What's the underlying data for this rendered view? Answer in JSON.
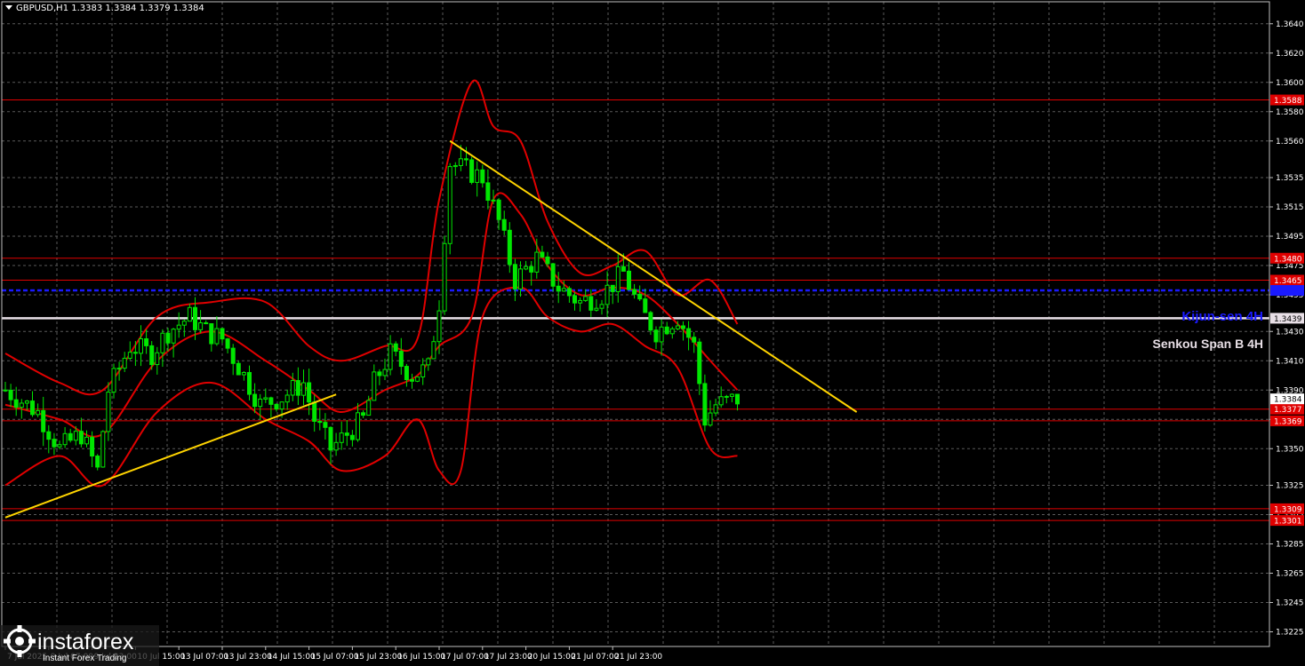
{
  "window": {
    "symbol_title": "GBPUSD,H1  1.3383 1.3384 1.3379 1.3384",
    "watermark_brand": "instaforex",
    "watermark_tagline": "Instant Forex Trading"
  },
  "colors": {
    "background": "#000000",
    "grid": "#5a5a5a",
    "candles": "#00e600",
    "bollinger": "#e00000",
    "level_red": "#e00000",
    "kijun": "#1a1aff",
    "senkou": "#e8dfe6",
    "trendline": "#ffd400"
  },
  "chart_data": {
    "type": "candlestick",
    "instrument": "GBPUSD",
    "timeframe": "H1",
    "title": "GBPUSD,H1  1.3383 1.3384 1.3379 1.3384",
    "ylim": [
      1.3215,
      1.3655
    ],
    "y_ticks": [
      "1.3640",
      "1.3620",
      "1.3600",
      "1.3580",
      "1.3560",
      "1.3535",
      "1.3515",
      "1.3495",
      "1.3475",
      "1.3455",
      "1.3430",
      "1.3410",
      "1.3390",
      "1.3370",
      "1.3350",
      "1.3325",
      "1.3305",
      "1.3285",
      "1.3265",
      "1.3245",
      "1.3225"
    ],
    "x_ticks": [
      "7 Jul 2025",
      "9 Jul 07:00",
      "9 Jul 23:00",
      "10 Jul 15:00",
      "13 Jul 07:00",
      "13 Jul 23:00",
      "14 Jul 15:00",
      "15 Jul 07:00",
      "15 Jul 23:00",
      "16 Jul 15:00",
      "17 Jul 07:00",
      "17 Jul 23:00",
      "20 Jul 15:00",
      "21 Jul 07:00",
      "21 Jul 23:00"
    ],
    "x_tick_bars": [
      0,
      8,
      16,
      24,
      32,
      40,
      48,
      56,
      64,
      72,
      80,
      88,
      96,
      104,
      112
    ],
    "bar_count": 150,
    "grid": true,
    "current_price": "1.3384",
    "current_price_value": 1.3384,
    "levels": [
      {
        "label": "1.3588",
        "value": 1.3588,
        "color": "#e00000"
      },
      {
        "label": "1.3480",
        "value": 1.348,
        "color": "#e00000"
      },
      {
        "label": "1.3465",
        "value": 1.3465,
        "color": "#e00000"
      },
      {
        "label": "1.3377",
        "value": 1.3377,
        "color": "#e00000"
      },
      {
        "label": "1.3369",
        "value": 1.3369,
        "color": "#e00000"
      },
      {
        "label": "1.3309",
        "value": 1.3309,
        "color": "#e00000"
      },
      {
        "label": "1.3301",
        "value": 1.3301,
        "color": "#e00000"
      }
    ],
    "kijun": {
      "label": "Kijun-sen 4H",
      "value": 1.3458,
      "color": "#1a1aff"
    },
    "senkou": {
      "label": "Senkou Span B 4H",
      "tag": "1.3439",
      "value": 1.3439,
      "color": "#e8dfe6"
    },
    "trendlines": [
      {
        "from": [
          0,
          1.3303
        ],
        "to": [
          61,
          1.3387
        ],
        "color": "#ffd400"
      },
      {
        "from": [
          82,
          1.356
        ],
        "to": [
          157,
          1.3375
        ],
        "color": "#ffd400"
      }
    ],
    "price_path": [
      [
        0,
        1.339
      ],
      [
        6,
        1.3375
      ],
      [
        10,
        1.335
      ],
      [
        14,
        1.336
      ],
      [
        17,
        1.3335
      ],
      [
        19,
        1.339
      ],
      [
        23,
        1.342
      ],
      [
        27,
        1.3415
      ],
      [
        30,
        1.343
      ],
      [
        34,
        1.344
      ],
      [
        37,
        1.343
      ],
      [
        40,
        1.3425
      ],
      [
        44,
        1.34
      ],
      [
        47,
        1.338
      ],
      [
        51,
        1.3385
      ],
      [
        55,
        1.3395
      ],
      [
        57,
        1.337
      ],
      [
        60,
        1.335
      ],
      [
        63,
        1.336
      ],
      [
        66,
        1.337
      ],
      [
        68,
        1.3395
      ],
      [
        71,
        1.3415
      ],
      [
        75,
        1.34
      ],
      [
        78,
        1.3405
      ],
      [
        80,
        1.345
      ],
      [
        82,
        1.3545
      ],
      [
        85,
        1.354
      ],
      [
        88,
        1.3535
      ],
      [
        91,
        1.3505
      ],
      [
        94,
        1.3465
      ],
      [
        98,
        1.348
      ],
      [
        102,
        1.346
      ],
      [
        106,
        1.345
      ],
      [
        110,
        1.3455
      ],
      [
        114,
        1.347
      ],
      [
        117,
        1.3445
      ],
      [
        120,
        1.343
      ],
      [
        124,
        1.344
      ],
      [
        127,
        1.342
      ],
      [
        129,
        1.337
      ],
      [
        131,
        1.338
      ],
      [
        135,
        1.3384
      ]
    ],
    "bollinger_bands": {
      "upper": [
        [
          0,
          1.3415
        ],
        [
          10,
          1.3395
        ],
        [
          18,
          1.339
        ],
        [
          28,
          1.344
        ],
        [
          38,
          1.345
        ],
        [
          48,
          1.345
        ],
        [
          56,
          1.342
        ],
        [
          62,
          1.341
        ],
        [
          70,
          1.342
        ],
        [
          76,
          1.3425
        ],
        [
          80,
          1.352
        ],
        [
          86,
          1.36
        ],
        [
          90,
          1.357
        ],
        [
          95,
          1.356
        ],
        [
          100,
          1.3505
        ],
        [
          106,
          1.347
        ],
        [
          112,
          1.3475
        ],
        [
          118,
          1.3485
        ],
        [
          124,
          1.3455
        ],
        [
          130,
          1.3465
        ],
        [
          135,
          1.3435
        ]
      ],
      "middle": [
        [
          0,
          1.338
        ],
        [
          10,
          1.337
        ],
        [
          18,
          1.336
        ],
        [
          28,
          1.341
        ],
        [
          38,
          1.343
        ],
        [
          48,
          1.341
        ],
        [
          56,
          1.339
        ],
        [
          62,
          1.3375
        ],
        [
          70,
          1.339
        ],
        [
          76,
          1.34
        ],
        [
          80,
          1.342
        ],
        [
          86,
          1.344
        ],
        [
          90,
          1.352
        ],
        [
          95,
          1.351
        ],
        [
          100,
          1.3475
        ],
        [
          106,
          1.3455
        ],
        [
          112,
          1.346
        ],
        [
          118,
          1.3455
        ],
        [
          124,
          1.3435
        ],
        [
          130,
          1.341
        ],
        [
          135,
          1.339
        ]
      ],
      "lower": [
        [
          0,
          1.3325
        ],
        [
          10,
          1.3345
        ],
        [
          18,
          1.3325
        ],
        [
          28,
          1.3375
        ],
        [
          38,
          1.3395
        ],
        [
          48,
          1.337
        ],
        [
          56,
          1.3355
        ],
        [
          62,
          1.3335
        ],
        [
          70,
          1.3345
        ],
        [
          76,
          1.337
        ],
        [
          80,
          1.3335
        ],
        [
          84,
          1.3335
        ],
        [
          88,
          1.344
        ],
        [
          95,
          1.346
        ],
        [
          100,
          1.344
        ],
        [
          106,
          1.343
        ],
        [
          112,
          1.3435
        ],
        [
          118,
          1.342
        ],
        [
          124,
          1.3405
        ],
        [
          130,
          1.335
        ],
        [
          135,
          1.3345
        ]
      ]
    }
  }
}
